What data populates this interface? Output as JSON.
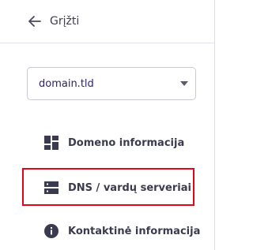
{
  "sidebar": {
    "back_label": "Grįžti",
    "domain_select": {
      "value": "domain.tld"
    },
    "items": [
      {
        "label": "Domeno informacija",
        "icon": "dashboard-icon"
      },
      {
        "label": "DNS / vardų serveriai",
        "icon": "server-icon"
      },
      {
        "label": "Kontaktinė informacija",
        "icon": "info-icon"
      }
    ]
  },
  "colors": {
    "highlight": "#e3061b",
    "icon": "#3b3b4f",
    "text": "#2f1c6a"
  }
}
